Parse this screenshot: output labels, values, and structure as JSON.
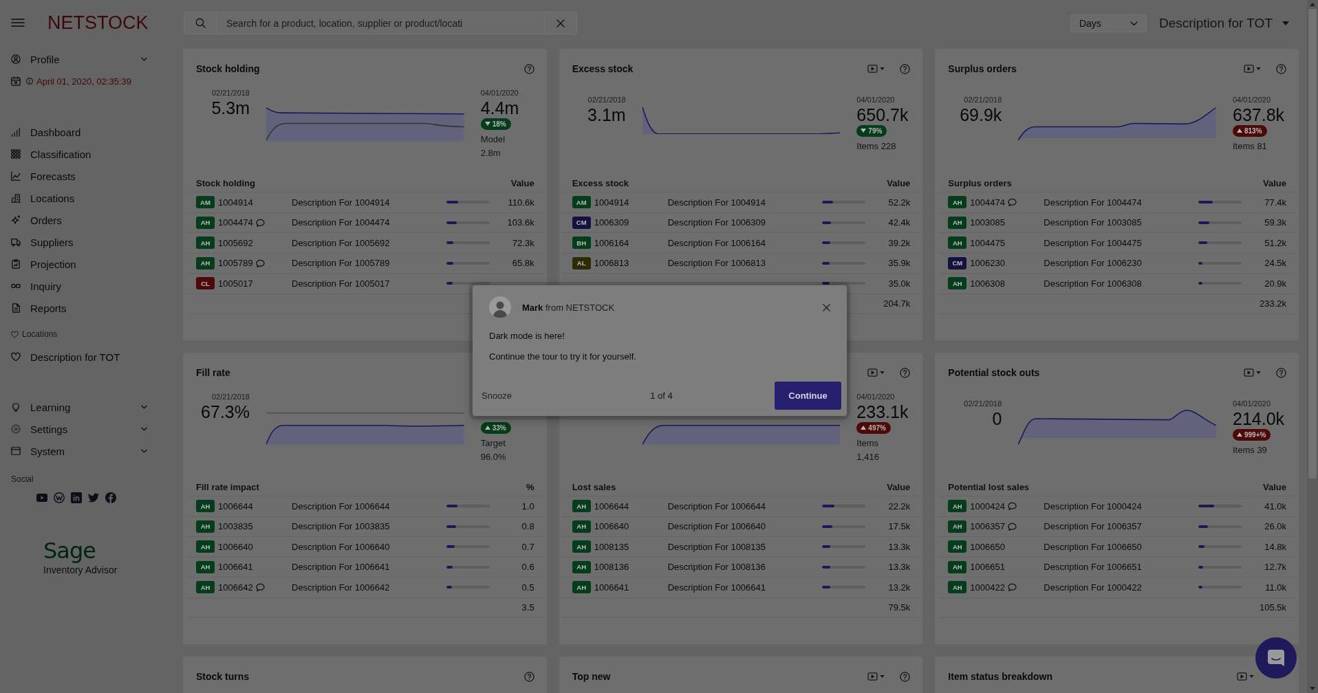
{
  "sidebar": {
    "logo": "NETSTOCK",
    "profile": {
      "label": "Profile",
      "expanded": false
    },
    "timestamp": "April 01, 2020, 02:35:39",
    "nav": [
      {
        "label": "Dashboard",
        "selected": false
      },
      {
        "label": "Classification",
        "selected": false
      },
      {
        "label": "Forecasts",
        "selected": false
      },
      {
        "label": "Locations",
        "selected": false
      },
      {
        "label": "Orders",
        "selected": false
      },
      {
        "label": "Suppliers",
        "selected": false
      },
      {
        "label": "Projection",
        "selected": false
      },
      {
        "label": "Inquiry",
        "selected": false
      },
      {
        "label": "Reports",
        "selected": false
      }
    ],
    "favorites_label": "Locations",
    "favorites": [
      {
        "label": "Description for TOT",
        "selected": false
      }
    ],
    "groups": [
      {
        "label": "Learning",
        "expanded": false
      },
      {
        "label": "Settings",
        "expanded": false
      },
      {
        "label": "System",
        "expanded": false
      }
    ],
    "social_label": "Social",
    "brand": {
      "logo": "Sage",
      "tagline": "Inventory Advisor"
    }
  },
  "topbar": {
    "search": {
      "placeholder": "Search for a product, location, supplier or product/locati"
    },
    "period": "Days",
    "location": "Description for TOT"
  },
  "cards": [
    {
      "title": "Stock holding",
      "media_menu": false,
      "help": true,
      "summary": {
        "start": {
          "date": "02/21/2018",
          "value": "5.3m"
        },
        "end": {
          "date": "04/01/2020",
          "value": "4.4m",
          "change": {
            "text": "18%",
            "rising": false,
            "color": "#053d1c"
          },
          "notes": [
            "Model",
            "2.8m"
          ]
        }
      },
      "table": {
        "label": "Stock holding",
        "value_label": "Value",
        "rows": [
          {
            "grade": "AM",
            "color": "#053d1c",
            "id": "1004914",
            "note": false,
            "description": "Description For 1004914",
            "level": 0.27,
            "value": "110.6k"
          },
          {
            "grade": "AH",
            "color": "#053d1c",
            "id": "1004474",
            "note": true,
            "description": "Description For 1004474",
            "level": 0.24,
            "value": "103.6k"
          },
          {
            "grade": "AH",
            "color": "#053d1c",
            "id": "1005692",
            "note": false,
            "description": "Description For 1005692",
            "level": 0.17,
            "value": "72.3k"
          },
          {
            "grade": "AH",
            "color": "#053d1c",
            "id": "1005789",
            "note": true,
            "description": "Description For 1005789",
            "level": 0.16,
            "value": "65.8k"
          },
          {
            "grade": "CL",
            "color": "#4d0808",
            "id": "1005017",
            "note": false,
            "description": "Description For 1005017",
            "level": 0.15
          }
        ]
      }
    },
    {
      "title": "Fill rate",
      "media_menu": false,
      "help": false,
      "summary": {
        "start": {
          "date": "02/21/2018",
          "value": "67.3%"
        },
        "end": {
          "change": {
            "text": "33%",
            "rising": true,
            "color": "#053d1c"
          },
          "notes": [
            "Target",
            "96.0%"
          ]
        }
      },
      "table": {
        "label": "Fill rate impact",
        "value_label": "%",
        "rows": [
          {
            "grade": "AH",
            "color": "#053d1c",
            "id": "1006644",
            "note": false,
            "description": "Description For 1006644",
            "level": 0.26,
            "value": "1.0"
          },
          {
            "grade": "AH",
            "color": "#053d1c",
            "id": "1003835",
            "note": false,
            "description": "Description For 1003835",
            "level": 0.22,
            "value": "0.8"
          },
          {
            "grade": "AH",
            "color": "#053d1c",
            "id": "1006640",
            "note": false,
            "description": "Description For 1006640",
            "level": 0.2,
            "value": "0.7"
          },
          {
            "grade": "AH",
            "color": "#053d1c",
            "id": "1006641",
            "note": false,
            "description": "Description For 1006641",
            "level": 0.15,
            "value": "0.6"
          },
          {
            "grade": "AH",
            "color": "#053d1c",
            "id": "1006642",
            "note": true,
            "description": "Description For 1006642",
            "level": 0.14,
            "value": "0.5"
          }
        ],
        "total": "3.5"
      }
    },
    {
      "title": "Stock turns",
      "media_menu": false,
      "help": true
    },
    {
      "title": "Excess stock",
      "media_menu": true,
      "help": true,
      "summary": {
        "start": {
          "date": "02/21/2018",
          "value": "3.1m"
        },
        "end": {
          "date": "04/01/2020",
          "value": "650.7k",
          "change": {
            "text": "79%",
            "rising": false,
            "color": "#053d1c"
          },
          "notes": [
            "Items 228"
          ]
        }
      },
      "table": {
        "label": "Excess stock",
        "value_label": "Value",
        "rows": [
          {
            "grade": "AM",
            "color": "#053d1c",
            "id": "1004914",
            "note": false,
            "description": "Description For 1004914",
            "level": 0.25,
            "value": "52.2k"
          },
          {
            "grade": "CM",
            "color": "#16123f",
            "id": "1006309",
            "note": false,
            "description": "Description For 1006309",
            "level": 0.2,
            "value": "42.4k"
          },
          {
            "grade": "BH",
            "color": "#053d1c",
            "id": "1006164",
            "note": false,
            "description": "Description For 1006164",
            "level": 0.19,
            "value": "39.2k"
          },
          {
            "grade": "AL",
            "color": "#2d2a07",
            "id": "1006813",
            "note": false,
            "description": "Description For 1006813",
            "level": 0.17,
            "value": "35.9k"
          },
          {
            "level": 0.17,
            "value": "35.0k"
          }
        ],
        "total": "204.7k"
      }
    },
    {
      "media_menu": true,
      "help": true,
      "summary": {
        "end": {
          "date": "04/01/2020",
          "value": "233.1k",
          "change": {
            "text": "497%",
            "rising": true,
            "color": "#4d0808"
          },
          "notes": [
            "Items",
            "1,416"
          ]
        }
      },
      "table": {
        "label": "Lost sales",
        "value_label": "Value",
        "rows": [
          {
            "grade": "AH",
            "color": "#053d1c",
            "id": "1006644",
            "note": false,
            "description": "Description For 1006644",
            "level": 0.28,
            "value": "22.2k"
          },
          {
            "grade": "AH",
            "color": "#053d1c",
            "id": "1006640",
            "note": false,
            "description": "Description For 1006640",
            "level": 0.23,
            "value": "17.5k"
          },
          {
            "grade": "AH",
            "color": "#053d1c",
            "id": "1008135",
            "note": false,
            "description": "Description For 1008135",
            "level": 0.18,
            "value": "13.3k"
          },
          {
            "grade": "AH",
            "color": "#053d1c",
            "id": "1008136",
            "note": false,
            "description": "Description For 1008136",
            "level": 0.18,
            "value": "13.3k"
          },
          {
            "grade": "AH",
            "color": "#053d1c",
            "id": "1006641",
            "note": false,
            "description": "Description For 1006641",
            "level": 0.18,
            "value": "13.2k"
          }
        ],
        "total": "79.5k"
      }
    },
    {
      "title": "Top new",
      "media_menu": true,
      "help": true
    },
    {
      "title": "Surplus orders",
      "media_menu": true,
      "help": true,
      "summary": {
        "start": {
          "date": "02/21/2018",
          "value": "69.9k"
        },
        "end": {
          "date": "04/01/2020",
          "value": "637.8k",
          "change": {
            "text": "813%",
            "rising": true,
            "color": "#4d0808"
          },
          "notes": [
            "Items 81"
          ]
        }
      },
      "table": {
        "label": "Surplus orders",
        "value_label": "Value",
        "rows": [
          {
            "grade": "AH",
            "color": "#053d1c",
            "id": "1004474",
            "note": true,
            "description": "Description For 1004474",
            "level": 0.33,
            "value": "77.4k"
          },
          {
            "grade": "AH",
            "color": "#053d1c",
            "id": "1003085",
            "note": false,
            "description": "Description For 1003085",
            "level": 0.25,
            "value": "59.3k"
          },
          {
            "grade": "AH",
            "color": "#053d1c",
            "id": "1004475",
            "note": false,
            "description": "Description For 1004475",
            "level": 0.21,
            "value": "51.2k"
          },
          {
            "grade": "CM",
            "color": "#16123f",
            "id": "1006230",
            "note": false,
            "description": "Description For 1006230",
            "level": 0.1,
            "value": "24.5k"
          },
          {
            "grade": "AH",
            "color": "#053d1c",
            "id": "1006308",
            "note": false,
            "description": "Description For 1006308",
            "level": 0.09,
            "value": "20.9k"
          }
        ],
        "total": "233.2k"
      }
    },
    {
      "title": "Potential stock outs",
      "media_menu": true,
      "help": true,
      "summary": {
        "start": {
          "date": "02/21/2018",
          "value": "0"
        },
        "end": {
          "date": "04/01/2020",
          "value": "214.0k",
          "change": {
            "text": "999+%",
            "rising": true,
            "color": "#4d0808"
          },
          "notes": [
            "Items 39"
          ]
        }
      },
      "table": {
        "label": "Potential lost sales",
        "value_label": "Value",
        "rows": [
          {
            "grade": "AH",
            "color": "#053d1c",
            "id": "1000424",
            "note": true,
            "description": "Description For 1000424",
            "level": 0.37,
            "value": "41.0k"
          },
          {
            "grade": "AH",
            "color": "#053d1c",
            "id": "1006357",
            "note": true,
            "description": "Description For 1006357",
            "level": 0.23,
            "value": "26.0k"
          },
          {
            "grade": "AH",
            "color": "#053d1c",
            "id": "1006650",
            "note": false,
            "description": "Description For 1006650",
            "level": 0.14,
            "value": "14.8k"
          },
          {
            "grade": "AH",
            "color": "#053d1c",
            "id": "1006651",
            "note": false,
            "description": "Description For 1006651",
            "level": 0.11,
            "value": "12.7k"
          },
          {
            "grade": "AH",
            "color": "#053d1c",
            "id": "1000422",
            "note": true,
            "description": "Description For 1000422",
            "level": 0.09,
            "value": "11.0k"
          }
        ],
        "total": "105.5k"
      }
    },
    {
      "title": "Item status breakdown",
      "media_menu": true,
      "help": false
    }
  ],
  "tour": {
    "sender": "**Mark** from NETSTOCK",
    "lines": [
      "Dark mode is here!",
      "Continue the tour to try it for yourself."
    ],
    "snooze": "Snooze",
    "step": "1 of 4",
    "action": "Continue"
  }
}
